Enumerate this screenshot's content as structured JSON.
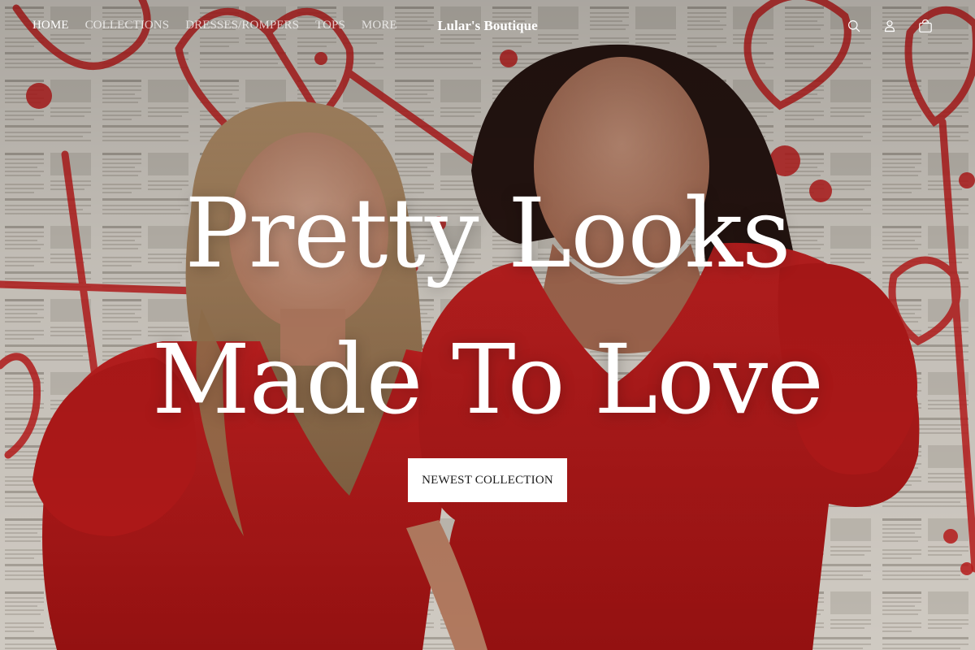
{
  "header": {
    "nav": [
      {
        "label": "HOME",
        "active": true
      },
      {
        "label": "COLLECTIONS",
        "active": false
      },
      {
        "label": "DRESSES/ROMPERS",
        "active": false
      },
      {
        "label": "TOPS",
        "active": false
      },
      {
        "label": "MORE",
        "active": false
      }
    ],
    "brand": "Lular's Boutique",
    "icons": [
      "search-icon",
      "account-icon",
      "cart-icon"
    ]
  },
  "hero": {
    "headline_line1": "Pretty Looks",
    "headline_line2": "Made To Love",
    "cta_label": "NEWEST COLLECTION"
  },
  "colors": {
    "accent_red": "#d21f1f",
    "text_light": "#ffffff",
    "button_bg": "#ffffff",
    "button_text": "#1a1a1a"
  }
}
